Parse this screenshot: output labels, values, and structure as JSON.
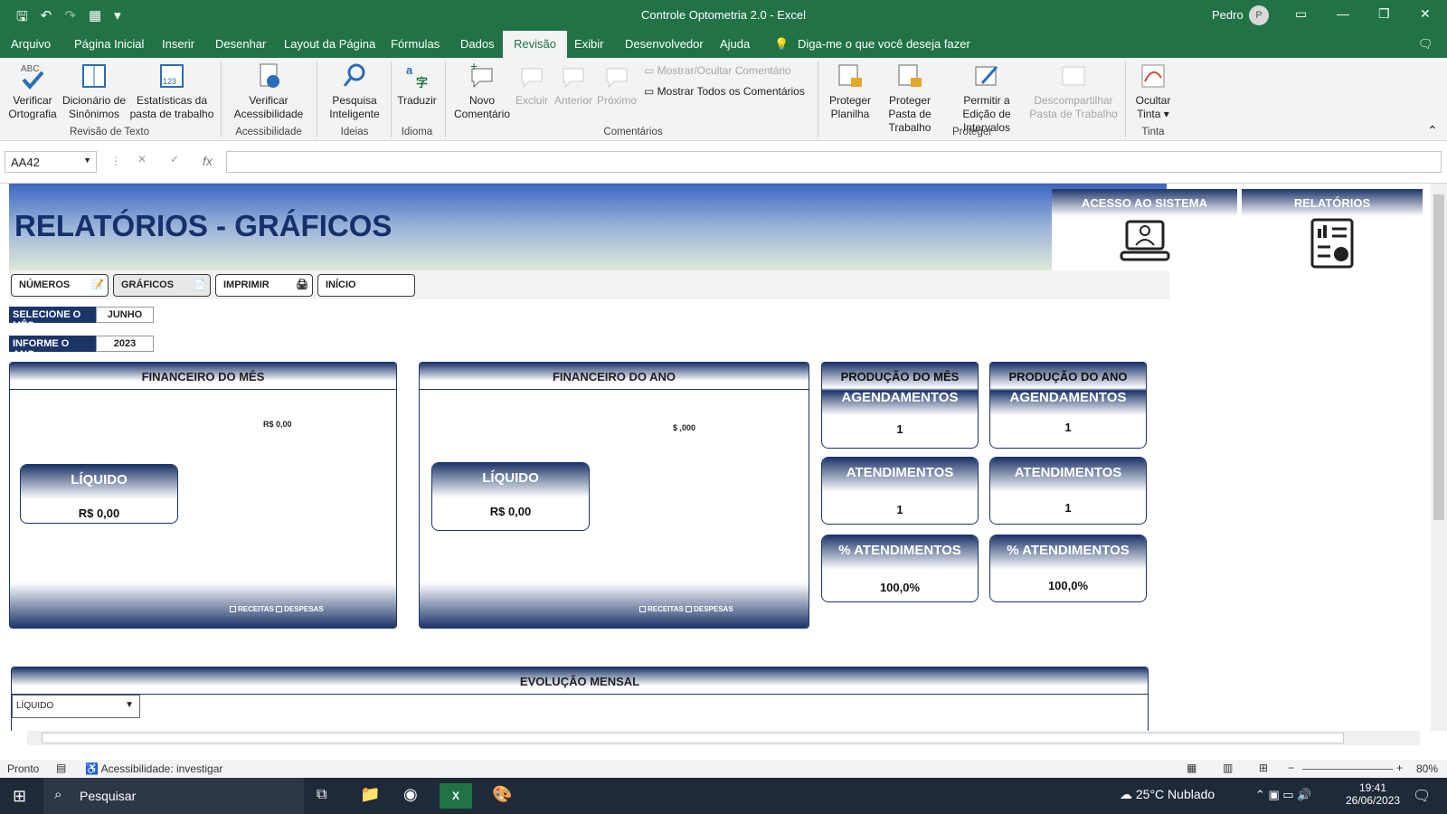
{
  "window": {
    "title": "Controle Optometria 2.0  -  Excel",
    "user": "Pedro",
    "avatar_initial": "P"
  },
  "ribbon_tabs": [
    "Arquivo",
    "Página Inicial",
    "Inserir",
    "Desenhar",
    "Layout da Página",
    "Fórmulas",
    "Dados",
    "Revisão",
    "Exibir",
    "Desenvolvedor",
    "Ajuda"
  ],
  "active_tab": "Revisão",
  "tell_me": "Diga-me o que você deseja fazer",
  "ribbon": {
    "verificar_ortografia": "Verificar Ortografia",
    "dicionario": "Dicionário de Sinônimos",
    "estatisticas": "Estatísticas da pasta de trabalho",
    "grp_revisao": "Revisão de Texto",
    "verificar_acess": "Verificar Acessibilidade",
    "grp_acess": "Acessibilidade",
    "pesquisa": "Pesquisa Inteligente",
    "grp_ideias": "Ideias",
    "traduzir": "Traduzir",
    "grp_idioma": "Idioma",
    "novo_coment": "Novo Comentário",
    "excluir": "Excluir",
    "anterior": "Anterior",
    "proximo": "Próximo",
    "mostrar_ocultar": "Mostrar/Ocultar Comentário",
    "mostrar_todos": "Mostrar Todos os Comentários",
    "grp_coment": "Comentários",
    "proteger_planilha": "Proteger Planilha",
    "proteger_pasta": "Proteger Pasta de Trabalho",
    "permitir_edicao": "Permitir a Edição de Intervalos",
    "descompartilhar": "Descompartilhar Pasta de Trabalho",
    "grp_proteger": "Proteger",
    "ocultar_tinta": "Ocultar Tinta",
    "grp_tinta": "Tinta"
  },
  "formula_bar": {
    "name_box": "AA42",
    "fx": "fx",
    "value": ""
  },
  "sheet": {
    "title": "RELATÓRIOS - GRÁFICOS",
    "acesso": "ACESSO AO SISTEMA",
    "relatorios": "RELATÓRIOS",
    "nav": [
      "NÚMEROS",
      "GRÁFICOS",
      "IMPRIMIR",
      "INÍCIO"
    ],
    "mes_label": "SELECIONE O MÊS",
    "mes_value": "JUNHO",
    "ano_label": "INFORME O ANO",
    "ano_value": "2023",
    "fin_mes": {
      "title": "FINANCEIRO DO MÊS",
      "value_label": "R$ 0,00",
      "liquido_label": "LÍQUIDO",
      "liquido_value": "R$ 0,00",
      "legend": [
        "RECEITAS",
        "DESPESAS"
      ]
    },
    "fin_ano": {
      "title": "FINANCEIRO DO ANO",
      "value_label": "$ ,000",
      "liquido_label": "LÍQUIDO",
      "liquido_value": "R$ 0,00",
      "legend": [
        "RECEITAS",
        "DESPESAS"
      ]
    },
    "prod_mes": {
      "title": "PRODUÇÃO DO MÊS",
      "agend": "AGENDAMENTOS",
      "agend_v": "1",
      "atend": "ATENDIMENTOS",
      "atend_v": "1",
      "pct": "% ATENDIMENTOS",
      "pct_v": "100,0%"
    },
    "prod_ano": {
      "title": "PRODUÇÃO DO ANO",
      "agend": "AGENDAMENTOS",
      "agend_v": "1",
      "atend": "ATENDIMENTOS",
      "atend_v": "1",
      "pct": "% ATENDIMENTOS",
      "pct_v": "100,0%"
    },
    "evolucao": "EVOLUÇÃO MENSAL",
    "evolucao_select": "LÍQUIDO"
  },
  "status": {
    "ready": "Pronto",
    "access": "Acessibilidade: investigar",
    "zoom": "80%"
  },
  "taskbar": {
    "search": "Pesquisar",
    "weather": "25°C  Nublado",
    "time": "19:41",
    "date": "26/06/2023"
  }
}
